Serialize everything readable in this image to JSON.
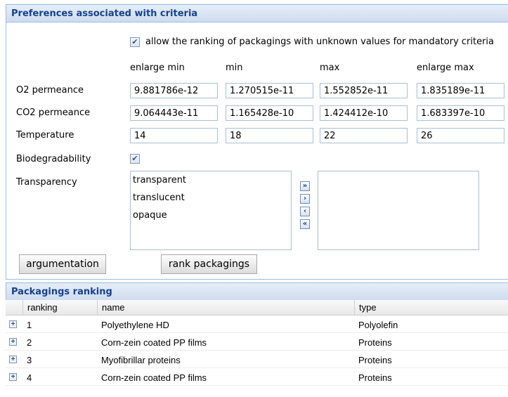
{
  "preferences": {
    "title": "Preferences associated with criteria",
    "allow_unknown_label": "allow the ranking of packagings with unknown values for mandatory criteria",
    "allow_unknown_checked": true,
    "columns": [
      "enlarge min",
      "min",
      "max",
      "enlarge max"
    ],
    "criteria": [
      {
        "label": "O2 permeance",
        "values": [
          "9.881786e-12",
          "1.270515e-11",
          "1.552852e-11",
          "1.835189e-11"
        ]
      },
      {
        "label": "CO2 permeance",
        "values": [
          "9.064443e-11",
          "1.165428e-10",
          "1.424412e-10",
          "1.683397e-10"
        ]
      },
      {
        "label": "Temperature",
        "values": [
          "14",
          "18",
          "22",
          "26"
        ]
      }
    ],
    "biodegradability_label": "Biodegradability",
    "biodegradability_checked": true,
    "transparency_label": "Transparency",
    "transparency_available": [
      "transparent",
      "translucent",
      "opaque"
    ],
    "transparency_selected": [],
    "move_buttons": [
      "move-all-right",
      "move-right",
      "move-left",
      "move-all-left"
    ],
    "argumentation_button": "argumentation",
    "rank_button": "rank packagings"
  },
  "ranking": {
    "title": "Packagings ranking",
    "columns": [
      "ranking",
      "name",
      "type"
    ],
    "rows": [
      {
        "ranking": "1",
        "name": "Polyethylene HD",
        "type": "Polyolefin"
      },
      {
        "ranking": "2",
        "name": "Corn-zein coated PP films",
        "type": "Proteins"
      },
      {
        "ranking": "3",
        "name": "Myofibrillar proteins",
        "type": "Proteins"
      },
      {
        "ranking": "4",
        "name": "Corn-zein coated PP films",
        "type": "Proteins"
      }
    ]
  }
}
